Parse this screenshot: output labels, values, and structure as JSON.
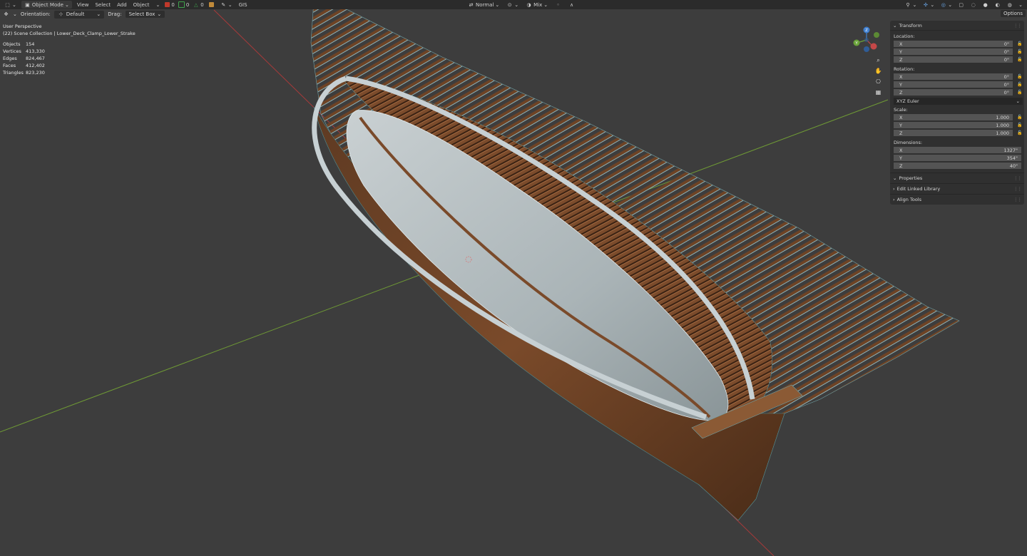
{
  "topbar": {
    "mode": "Object Mode",
    "menu": [
      "View",
      "Select",
      "Add",
      "Object"
    ],
    "counters": [
      {
        "value": "0",
        "color": "#c0392b"
      },
      {
        "value": "0",
        "color": "#3fa34d"
      },
      {
        "value": "0",
        "color": "#3fa34d"
      }
    ],
    "gis_label": "GIS",
    "shading": "Normal",
    "mix": "Mix",
    "options": "Options"
  },
  "toolbar": {
    "orientation_label": "Orientation:",
    "orientation_value": "Default",
    "drag_label": "Drag:",
    "drag_value": "Select Box"
  },
  "viewport": {
    "perspective": "User Perspective",
    "collection": "(22) Scene Collection | Lower_Deck_Clamp_Lower_Strake",
    "stats": [
      {
        "label": "Objects",
        "value": "154"
      },
      {
        "label": "Vertices",
        "value": "413,330"
      },
      {
        "label": "Edges",
        "value": "824,467"
      },
      {
        "label": "Faces",
        "value": "412,402"
      },
      {
        "label": "Triangles",
        "value": "823,230"
      }
    ]
  },
  "gizmo": {
    "x_label": "X",
    "y_label": "Y",
    "z_label": "Z"
  },
  "panel": {
    "transform_title": "Transform",
    "location_label": "Location:",
    "location": [
      {
        "axis": "X",
        "value": "0\""
      },
      {
        "axis": "Y",
        "value": "0\""
      },
      {
        "axis": "Z",
        "value": "0\""
      }
    ],
    "rotation_label": "Rotation:",
    "rotation": [
      {
        "axis": "X",
        "value": "0°"
      },
      {
        "axis": "Y",
        "value": "0°"
      },
      {
        "axis": "Z",
        "value": "0°"
      }
    ],
    "rotation_mode": "XYZ Euler",
    "scale_label": "Scale:",
    "scale": [
      {
        "axis": "X",
        "value": "1.000"
      },
      {
        "axis": "Y",
        "value": "1.000"
      },
      {
        "axis": "Z",
        "value": "1.000"
      }
    ],
    "dimensions_label": "Dimensions:",
    "dimensions": [
      {
        "axis": "X",
        "value": "1327\""
      },
      {
        "axis": "Y",
        "value": "354\""
      },
      {
        "axis": "Z",
        "value": "40\""
      }
    ],
    "properties_title": "Properties",
    "edit_linked_title": "Edit Linked Library",
    "align_tools_title": "Align Tools"
  }
}
